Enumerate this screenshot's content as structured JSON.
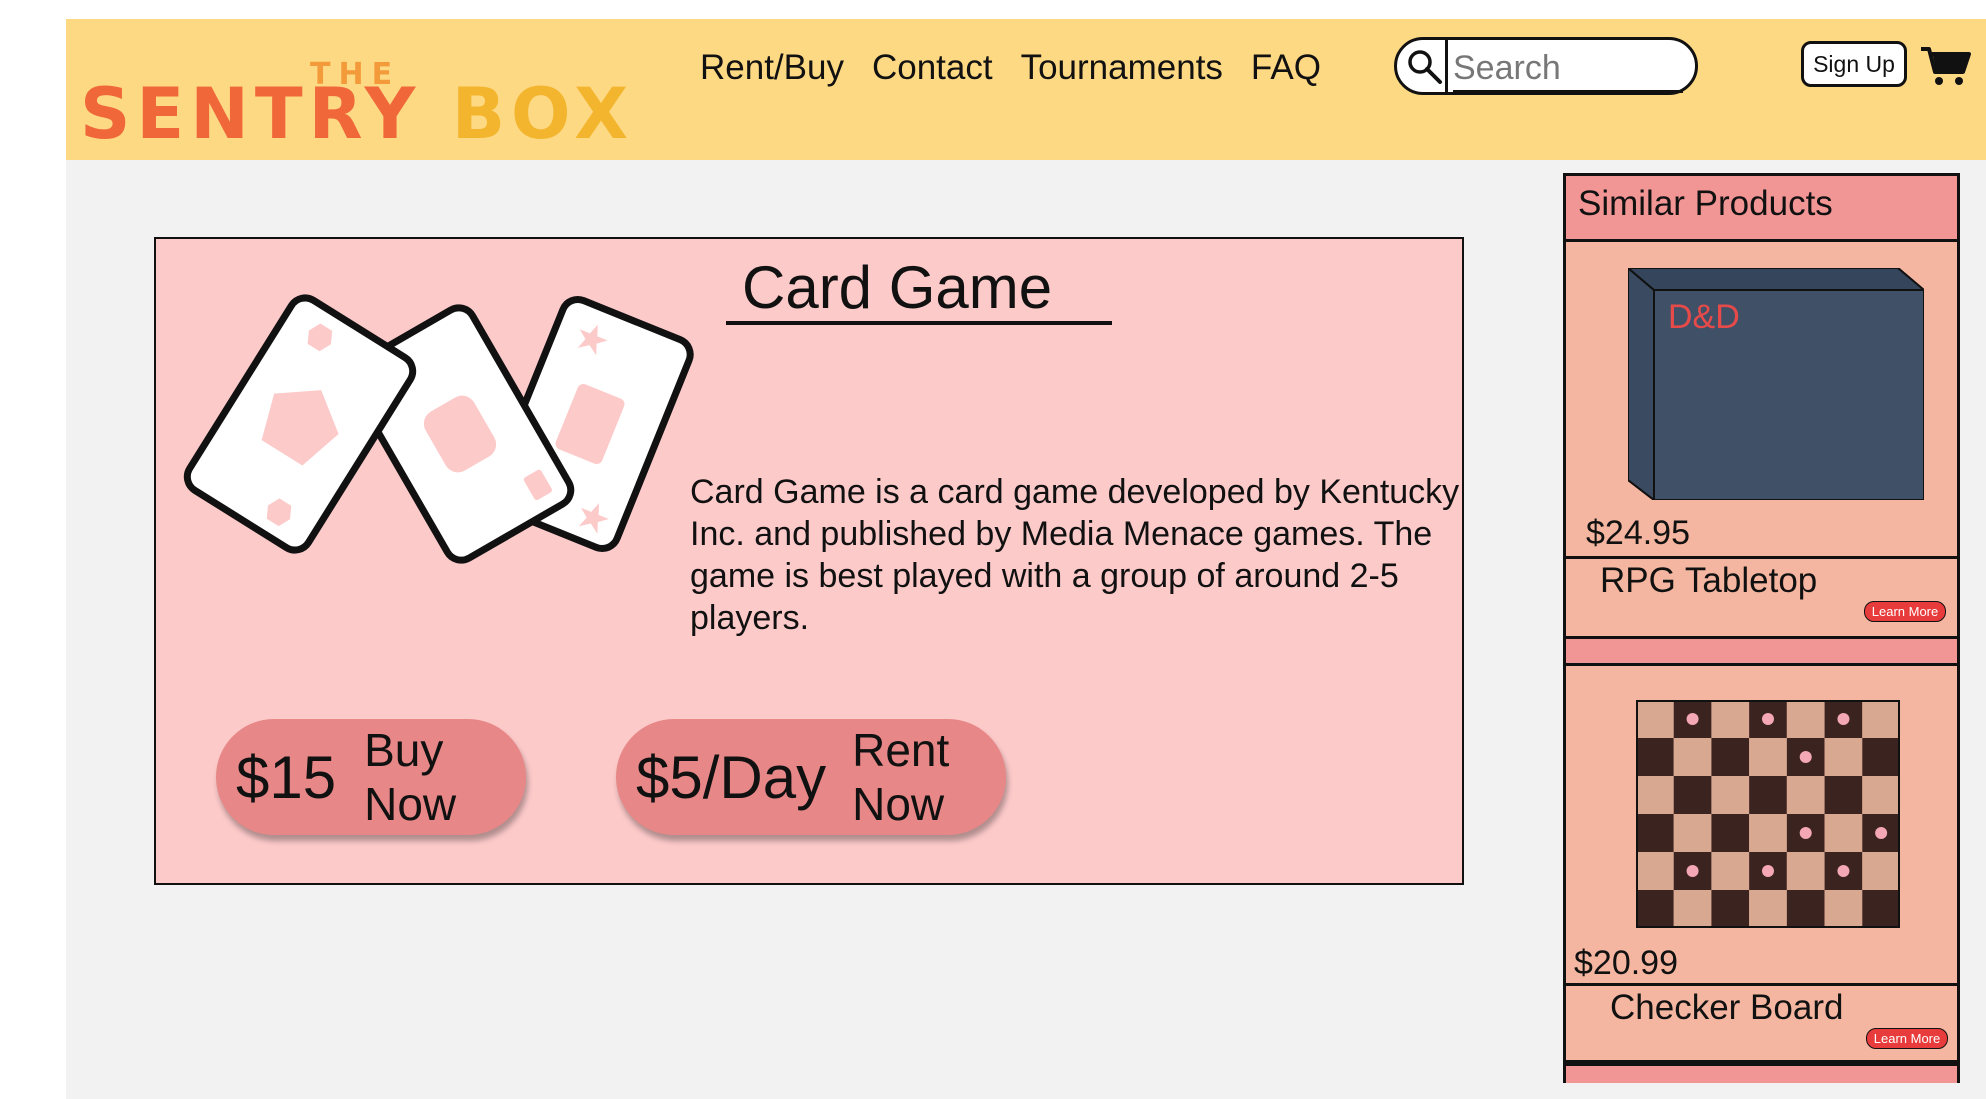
{
  "header": {
    "logo": {
      "the": "THE",
      "word1": "SENTRY",
      "word2": "BOX"
    },
    "nav": [
      "Rent/Buy",
      "Contact",
      "Tournaments",
      "FAQ"
    ],
    "search": {
      "placeholder": "Search"
    },
    "signup_label": "Sign Up",
    "colors": {
      "bar": "#fed983",
      "logo_main": "#f0673a",
      "logo_accent": "#f4b52e"
    }
  },
  "product": {
    "title": "Card Game",
    "description": "Card Game is a card game developed by Kentucky Inc. and published by Media Menace games. The game is best played with a group of around 2-5 players.",
    "buy": {
      "price": "$15",
      "label_line1": "Buy",
      "label_line2": "Now"
    },
    "rent": {
      "price": "$5/Day",
      "label_line1": "Rent",
      "label_line2": "Now"
    },
    "colors": {
      "card_bg": "#fdcaca",
      "button": "#e88787"
    }
  },
  "sidebar": {
    "title": "Similar Products",
    "items": [
      {
        "box_label": "D&D",
        "price": "$24.95",
        "name": "RPG Tabletop",
        "action": "Learn More"
      },
      {
        "price": "$20.99",
        "name": "Checker Board",
        "action": "Learn More"
      }
    ],
    "colors": {
      "header": "#f29595",
      "body": "#f4b6a0",
      "learn_more": "#e83b3b"
    }
  }
}
